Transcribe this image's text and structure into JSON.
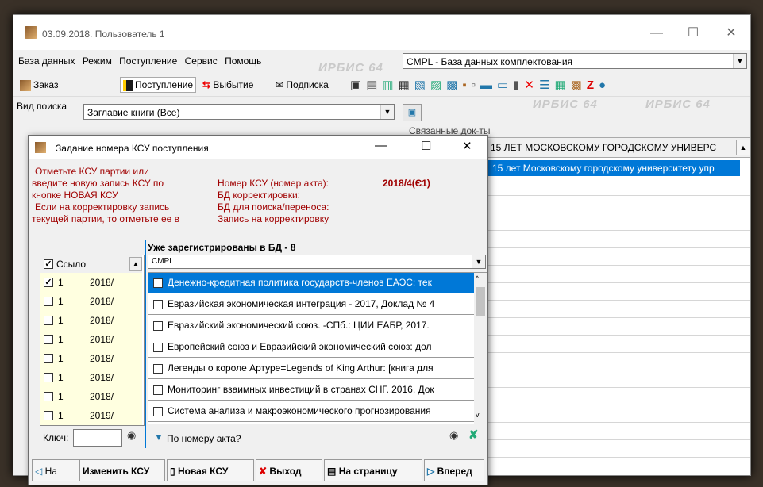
{
  "window": {
    "title": "03.09.2018. Пользователь 1"
  },
  "menu": [
    "База данных",
    "Режим",
    "Поступление",
    "Сервис",
    "Помощь"
  ],
  "toolbar": {
    "order": "Заказ",
    "receipt": "Поступление",
    "disposal": "Выбытие",
    "subscription": "Подписка"
  },
  "database_combo": {
    "value": "CMPL - База данных комплектования"
  },
  "search": {
    "label": "Вид поиска",
    "value": "Заглавие книги (Все)"
  },
  "watermark": "ИРБИС 64",
  "related": {
    "label": "Связанные док-ты",
    "header": "15 ЛЕТ МОСКОВСКОМУ ГОРОДСКОМУ УНИВЕРС",
    "selected": "15 лет Московскому городскому университету упр"
  },
  "dialog": {
    "title": "Задание номера КСУ поступления",
    "instructions": [
      "Отметьте КСУ партии или",
      "введите новую запись КСУ по",
      "кнопке НОВАЯ КСУ",
      "Если на корректировку запись",
      "текущей партии, то отметьте ее в"
    ],
    "info_labels": [
      "Номер КСУ (номер акта):",
      "БД корректировки:",
      "БД для поиска/переноса:",
      "Запись на корректировку"
    ],
    "ksu_number": "2018/4(Є1)",
    "left_table": {
      "header": "Ссыло",
      "rows": [
        {
          "checked": true,
          "ref": "1",
          "year": "2018/"
        },
        {
          "checked": false,
          "ref": "1",
          "year": "2018/"
        },
        {
          "checked": false,
          "ref": "1",
          "year": "2018/"
        },
        {
          "checked": false,
          "ref": "1",
          "year": "2018/"
        },
        {
          "checked": false,
          "ref": "1",
          "year": "2018/"
        },
        {
          "checked": false,
          "ref": "1",
          "year": "2018/"
        },
        {
          "checked": false,
          "ref": "1",
          "year": "2018/"
        },
        {
          "checked": false,
          "ref": "1",
          "year": "2019/"
        }
      ]
    },
    "key_label": "Ключ:",
    "registered": {
      "title": "Уже зарегистрированы в БД - 8",
      "db": "CMPL",
      "items": [
        "Денежно-кредитная политика государств-членов ЕАЭС: тек",
        "Евразийская экономическая интеграция - 2017, Доклад № 4",
        "Евразийский экономический союз. -СПб.: ЦИИ ЕАБР, 2017.",
        "Европейский союз и Евразийский экономический союз: дол",
        "Легенды о короле Артуре=Legends of King Arthur: [книга для",
        "Мониторинг взаимных инвестиций в странах СНГ. 2016, Док",
        "Система анализа и макроэкономического прогнозирования"
      ],
      "filter": "По номеру акта?"
    },
    "buttons": {
      "back": "На",
      "edit": "Изменить КСУ",
      "new": "Новая КСУ",
      "exit": "Выход",
      "to_page": "На страницу",
      "forward": "Вперед"
    }
  },
  "colors": {
    "accent": "#0078d7",
    "instruction_red": "#a00000",
    "row_yellow": "#ffffe0"
  }
}
